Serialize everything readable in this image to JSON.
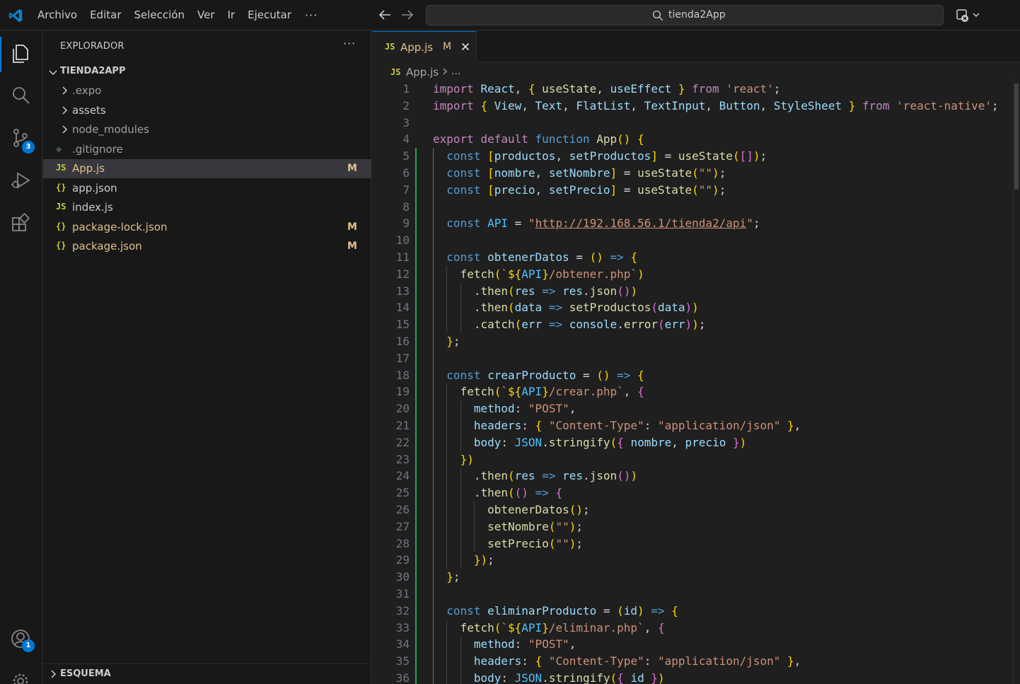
{
  "titlebar": {
    "menu": [
      "Archivo",
      "Editar",
      "Selección",
      "Ver",
      "Ir",
      "Ejecutar"
    ],
    "more": "···",
    "search_text": "tienda2App"
  },
  "activity": {
    "source_control_badge": "3",
    "accounts_badge": "1"
  },
  "sidebar": {
    "title": "EXPLORADOR",
    "more": "···",
    "root": "TIENDA2APP",
    "items": [
      {
        "name": ".expo",
        "type": "folder",
        "status": ""
      },
      {
        "name": "assets",
        "type": "folder",
        "status": ""
      },
      {
        "name": "node_modules",
        "type": "folder",
        "status": ""
      },
      {
        "name": ".gitignore",
        "type": "git",
        "status": ""
      },
      {
        "name": "App.js",
        "type": "js",
        "status": "M"
      },
      {
        "name": "app.json",
        "type": "json",
        "status": ""
      },
      {
        "name": "index.js",
        "type": "js",
        "status": ""
      },
      {
        "name": "package-lock.json",
        "type": "json",
        "status": "M"
      },
      {
        "name": "package.json",
        "type": "json",
        "status": "M"
      }
    ],
    "outline": "ESQUEMA"
  },
  "editor": {
    "tab": {
      "icon": "JS",
      "name": "App.js",
      "status": "M"
    },
    "breadcrumb": {
      "icon": "JS",
      "file": "App.js",
      "more": "..."
    },
    "lines": [
      "import React, { useState, useEffect } from 'react';",
      "import { View, Text, FlatList, TextInput, Button, StyleSheet } from 'react-native';",
      "",
      "export default function App() {",
      "  const [productos, setProductos] = useState([]);",
      "  const [nombre, setNombre] = useState(\"\");",
      "  const [precio, setPrecio] = useState(\"\");",
      "",
      "  const API = \"http://192.168.56.1/tienda2/api\";",
      "",
      "  const obtenerDatos = () => {",
      "    fetch(`${API}/obtener.php`)",
      "      .then(res => res.json())",
      "      .then(data => setProductos(data))",
      "      .catch(err => console.error(err));",
      "  };",
      "",
      "  const crearProducto = () => {",
      "    fetch(`${API}/crear.php`, {",
      "      method: \"POST\",",
      "      headers: { \"Content-Type\": \"application/json\" },",
      "      body: JSON.stringify({ nombre, precio })",
      "    })",
      "      .then(res => res.json())",
      "      .then(() => {",
      "        obtenerDatos();",
      "        setNombre(\"\");",
      "        setPrecio(\"\");",
      "      });",
      "  };",
      "",
      "  const eliminarProducto = (id) => {",
      "    fetch(`${API}/eliminar.php`, {",
      "      method: \"POST\",",
      "      headers: { \"Content-Type\": \"application/json\" },",
      "      body: JSON.stringify({ id })"
    ]
  }
}
